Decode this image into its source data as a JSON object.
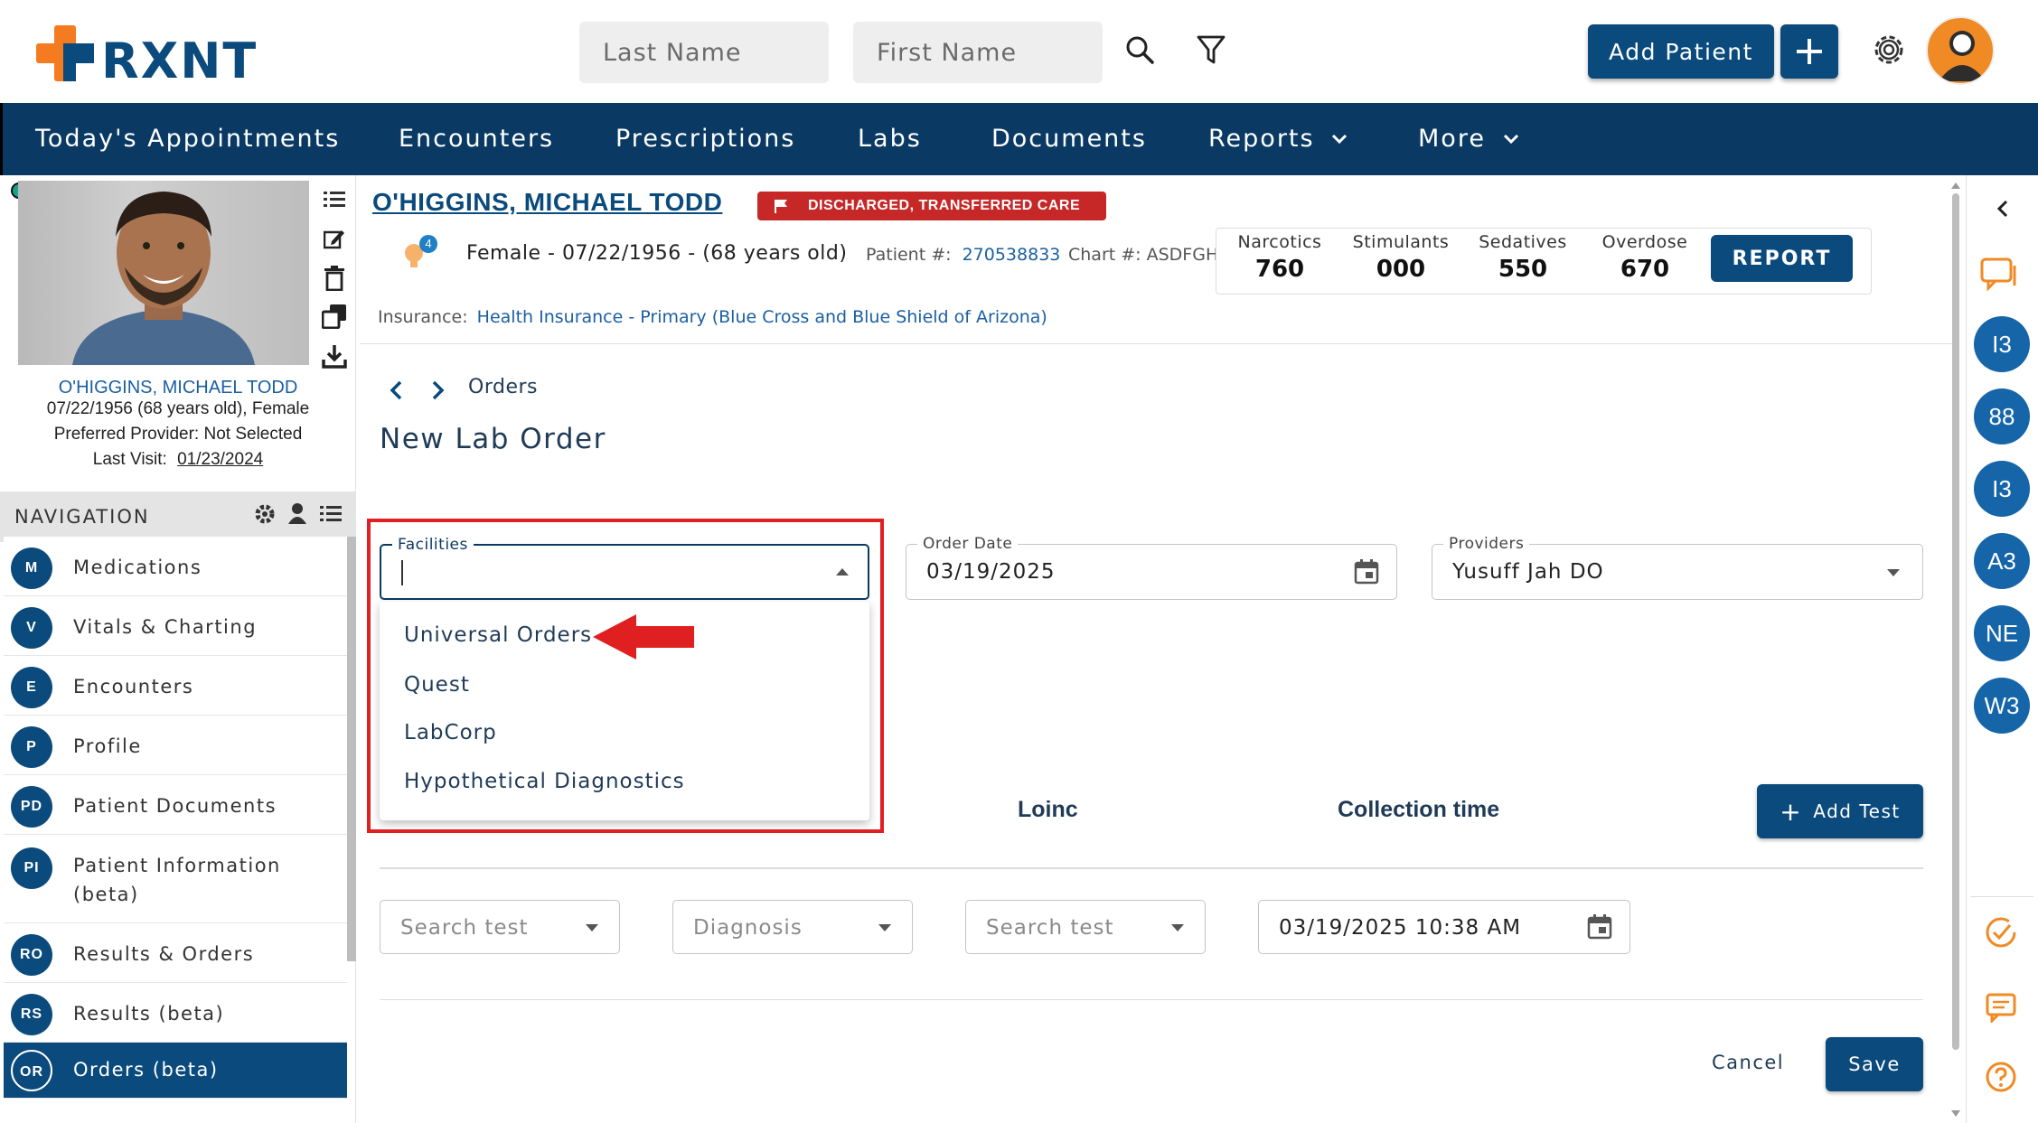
{
  "header": {
    "logo_text": "RXNT",
    "last_name_placeholder": "Last Name",
    "first_name_placeholder": "First Name",
    "add_patient_label": "Add Patient"
  },
  "navbar": {
    "items": [
      "Today's Appointments",
      "Encounters",
      "Prescriptions",
      "Labs",
      "Documents",
      "Reports",
      "More"
    ]
  },
  "patient_card": {
    "name": "O'HIGGINS, MICHAEL TODD",
    "dob_line": "07/22/1956 (68 years old), Female",
    "provider_line": "Preferred Provider: Not Selected",
    "last_visit_label": "Last Visit:",
    "last_visit_date": "01/23/2024"
  },
  "navigation": {
    "title": "NAVIGATION",
    "items": [
      {
        "abbr": "M",
        "label": "Medications"
      },
      {
        "abbr": "V",
        "label": "Vitals & Charting"
      },
      {
        "abbr": "E",
        "label": "Encounters"
      },
      {
        "abbr": "P",
        "label": "Profile"
      },
      {
        "abbr": "PD",
        "label": "Patient Documents"
      },
      {
        "abbr": "PI",
        "label": "Patient Information (beta)"
      },
      {
        "abbr": "RO",
        "label": "Results & Orders"
      },
      {
        "abbr": "RS",
        "label": "Results (beta)"
      },
      {
        "abbr": "OR",
        "label": "Orders (beta)"
      }
    ]
  },
  "patient_header": {
    "name": "O'HIGGINS, MICHAEL TODD",
    "status_badge": "DISCHARGED, TRANSFERRED CARE",
    "notification_count": "4",
    "demographics": "Female - 07/22/1956 - (68 years old)",
    "patient_num_label": "Patient #:",
    "patient_num": "270538833",
    "chart_label": "Chart #: ASDFGH",
    "insurance_label": "Insurance:",
    "insurance_value": "Health Insurance - Primary (Blue Cross and Blue Shield of Arizona)"
  },
  "stats": {
    "items": [
      {
        "label": "Narcotics",
        "value": "760"
      },
      {
        "label": "Stimulants",
        "value": "000"
      },
      {
        "label": "Sedatives",
        "value": "550"
      },
      {
        "label": "Overdose",
        "value": "670"
      }
    ],
    "report_label": "REPORT"
  },
  "page": {
    "breadcrumb": "Orders",
    "title": "New Lab Order"
  },
  "form": {
    "facilities_label": "Facilities",
    "facilities_options": [
      "Universal Orders",
      "Quest",
      "LabCorp",
      "Hypothetical Diagnostics"
    ],
    "order_date_label": "Order Date",
    "order_date_value": "03/19/2025",
    "providers_label": "Providers",
    "providers_value": "Yusuff Jah DO"
  },
  "table": {
    "columns": [
      "Loinc",
      "Collection time"
    ],
    "add_test_label": "Add Test",
    "row": {
      "test_placeholder": "Search test",
      "diagnosis_placeholder": "Diagnosis",
      "test2_placeholder": "Search test",
      "collection_value": "03/19/2025 10:38 AM"
    }
  },
  "actions": {
    "cancel_label": "Cancel",
    "save_label": "Save"
  },
  "right_rail": {
    "items": [
      "I3",
      "88",
      "I3",
      "A3",
      "NE",
      "W3"
    ]
  },
  "colors": {
    "brand_navy": "#0a3a63",
    "button_blue": "#0a4a7c",
    "logo_orange": "#f47b20",
    "alert_red": "#c62828",
    "highlight_red": "#e02020",
    "accent_orange": "#f08a24"
  }
}
